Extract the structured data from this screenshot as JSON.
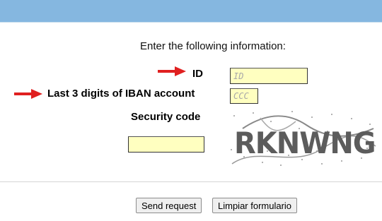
{
  "header": {
    "bar_color": "#85b7e0"
  },
  "form": {
    "instructions": "Enter the following information:",
    "id_label": "ID",
    "id_placeholder": "ID",
    "iban_label": "Last 3 digits of IBAN account",
    "iban_placeholder": "CCC",
    "security_label": "Security code",
    "captcha_text": "RKNWNG",
    "input_color": "#ffffc0",
    "arrow_color": "#e02020"
  },
  "buttons": {
    "send": "Send request",
    "clear": "Limpiar formulario"
  }
}
